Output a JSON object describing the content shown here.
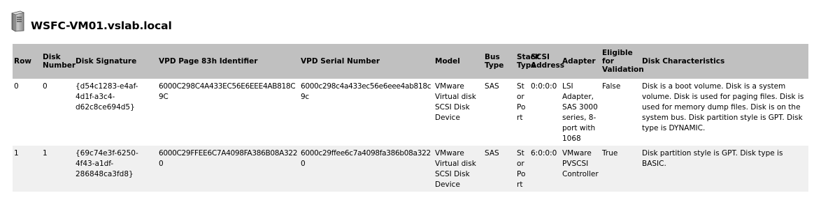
{
  "header": {
    "icon": "server-icon",
    "title": "WSFC-VM01.vslab.local"
  },
  "table": {
    "columns": [
      {
        "key": "row",
        "label": "Row"
      },
      {
        "key": "disk_number",
        "label": "Disk Number"
      },
      {
        "key": "disk_signature",
        "label": "Disk Signature"
      },
      {
        "key": "vpd_page_83h",
        "label": "VPD Page 83h Identifier"
      },
      {
        "key": "vpd_serial",
        "label": "VPD Serial Number"
      },
      {
        "key": "model",
        "label": "Model"
      },
      {
        "key": "bus_type",
        "label": "Bus Type"
      },
      {
        "key": "stack_type",
        "label": "Stack Type"
      },
      {
        "key": "scsi_address",
        "label": "SCSI Address"
      },
      {
        "key": "adapter",
        "label": "Adapter"
      },
      {
        "key": "eligible",
        "label": "Eligible for Validation"
      },
      {
        "key": "characteristics",
        "label": "Disk Characteristics"
      }
    ],
    "rows": [
      {
        "row": "0",
        "disk_number": "0",
        "disk_signature": "{d54c1283-e4af-4d1f-a3c4-d62c8ce694d5}",
        "vpd_page_83h": "6000C298C4A433EC56E6EEE4AB818C9C",
        "vpd_serial": "6000c298c4a433ec56e6eee4ab818c9c",
        "model": "VMware Virtual disk SCSI Disk Device",
        "bus_type": "SAS",
        "stack_type": "Stor Port",
        "scsi_address": "0:0:0:0",
        "adapter": "LSI Adapter, SAS 3000 series, 8-port with 1068",
        "eligible": "False",
        "characteristics": "Disk is a boot volume. Disk is a system volume. Disk is used for paging files. Disk is used for memory dump files. Disk is on the system bus. Disk partition style is GPT. Disk type is DYNAMIC."
      },
      {
        "row": "1",
        "disk_number": "1",
        "disk_signature": "{69c74e3f-6250-4f43-a1df-286848ca3fd8}",
        "vpd_page_83h": "6000C29FFEE6C7A4098FA386B08A3220",
        "vpd_serial": "6000c29ffee6c7a4098fa386b08a3220",
        "model": "VMware Virtual disk SCSI Disk Device",
        "bus_type": "SAS",
        "stack_type": "Stor Port",
        "scsi_address": "6:0:0:0",
        "adapter": "VMware PVSCSI Controller",
        "eligible": "True",
        "characteristics": "Disk partition style is GPT. Disk type is BASIC."
      }
    ]
  }
}
